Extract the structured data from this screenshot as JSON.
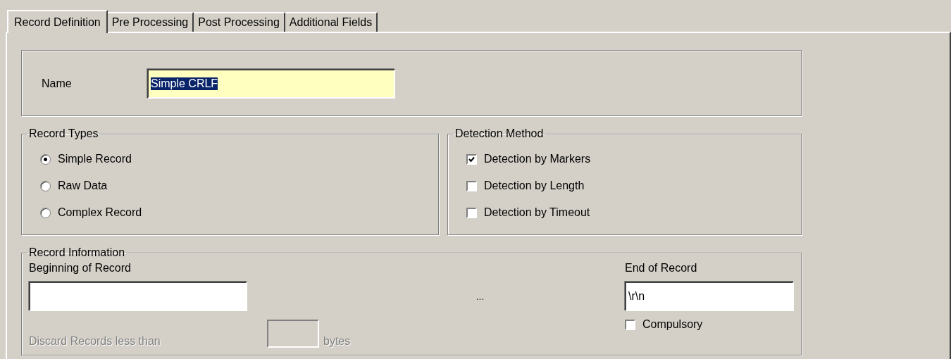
{
  "tabs": [
    {
      "label": "Record Definition",
      "selected": true
    },
    {
      "label": "Pre Processing",
      "selected": false
    },
    {
      "label": "Post Processing",
      "selected": false
    },
    {
      "label": "Additional Fields",
      "selected": false
    }
  ],
  "name_field": {
    "label": "Name",
    "value": "Simple CRLF",
    "text_selected": true
  },
  "record_types": {
    "title": "Record Types",
    "options": [
      {
        "label": "Simple Record",
        "selected": true
      },
      {
        "label": "Raw Data",
        "selected": false
      },
      {
        "label": "Complex Record",
        "selected": false
      }
    ]
  },
  "detection_method": {
    "title": "Detection Method",
    "options": [
      {
        "label": "Detection by Markers",
        "checked": true
      },
      {
        "label": "Detection by Length",
        "checked": false
      },
      {
        "label": "Detection by Timeout",
        "checked": false
      }
    ]
  },
  "record_information": {
    "title": "Record Information",
    "beginning": {
      "label": "Beginning of Record"
    },
    "separator": "...",
    "end": {
      "label": "End of Record",
      "value": "\\r\\n"
    },
    "compulsory": {
      "label": "Compulsory",
      "checked": false
    },
    "discard": {
      "label": "Discard Records less than",
      "unit": "bytes",
      "disabled": true
    }
  }
}
